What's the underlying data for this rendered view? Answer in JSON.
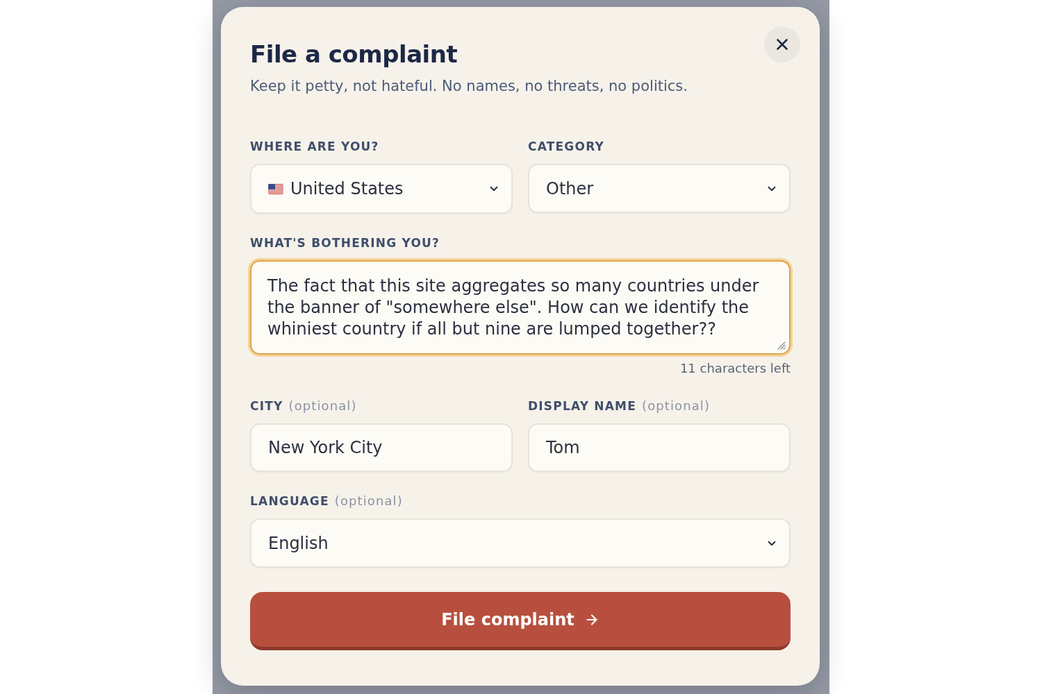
{
  "dialog": {
    "title": "File a complaint",
    "subtitle": "Keep it petty, not hateful. No names, no threats, no politics."
  },
  "rows": [
    {
      "fields": [
        {
          "kind": "country",
          "label": "WHERE ARE YOU?",
          "value": "United States",
          "focused": false
        },
        {
          "kind": "select",
          "label": "CATEGORY",
          "value": "Other",
          "focused": false
        }
      ]
    },
    {
      "fields": [
        {
          "kind": "textarea",
          "label": "WHAT'S BOTHERING YOU?",
          "value": "The fact that this site aggregates so many countries under the banner of \"somewhere else\". How can we identify the whiniest country if all but nine are lumped together??",
          "focused": true,
          "counter": "11 characters left"
        }
      ]
    },
    {
      "fields": [
        {
          "kind": "text",
          "label": "CITY",
          "hint": "(optional)",
          "value": "New York City",
          "focused": false
        },
        {
          "kind": "text",
          "label": "DISPLAY NAME",
          "hint": "(optional)",
          "value": "Tom",
          "focused": false
        }
      ]
    },
    {
      "fields": [
        {
          "kind": "select",
          "label": "LANGUAGE",
          "hint": "(optional)",
          "value": "English",
          "focused": false
        }
      ]
    }
  ],
  "submit_button": {
    "label": "File complaint"
  }
}
